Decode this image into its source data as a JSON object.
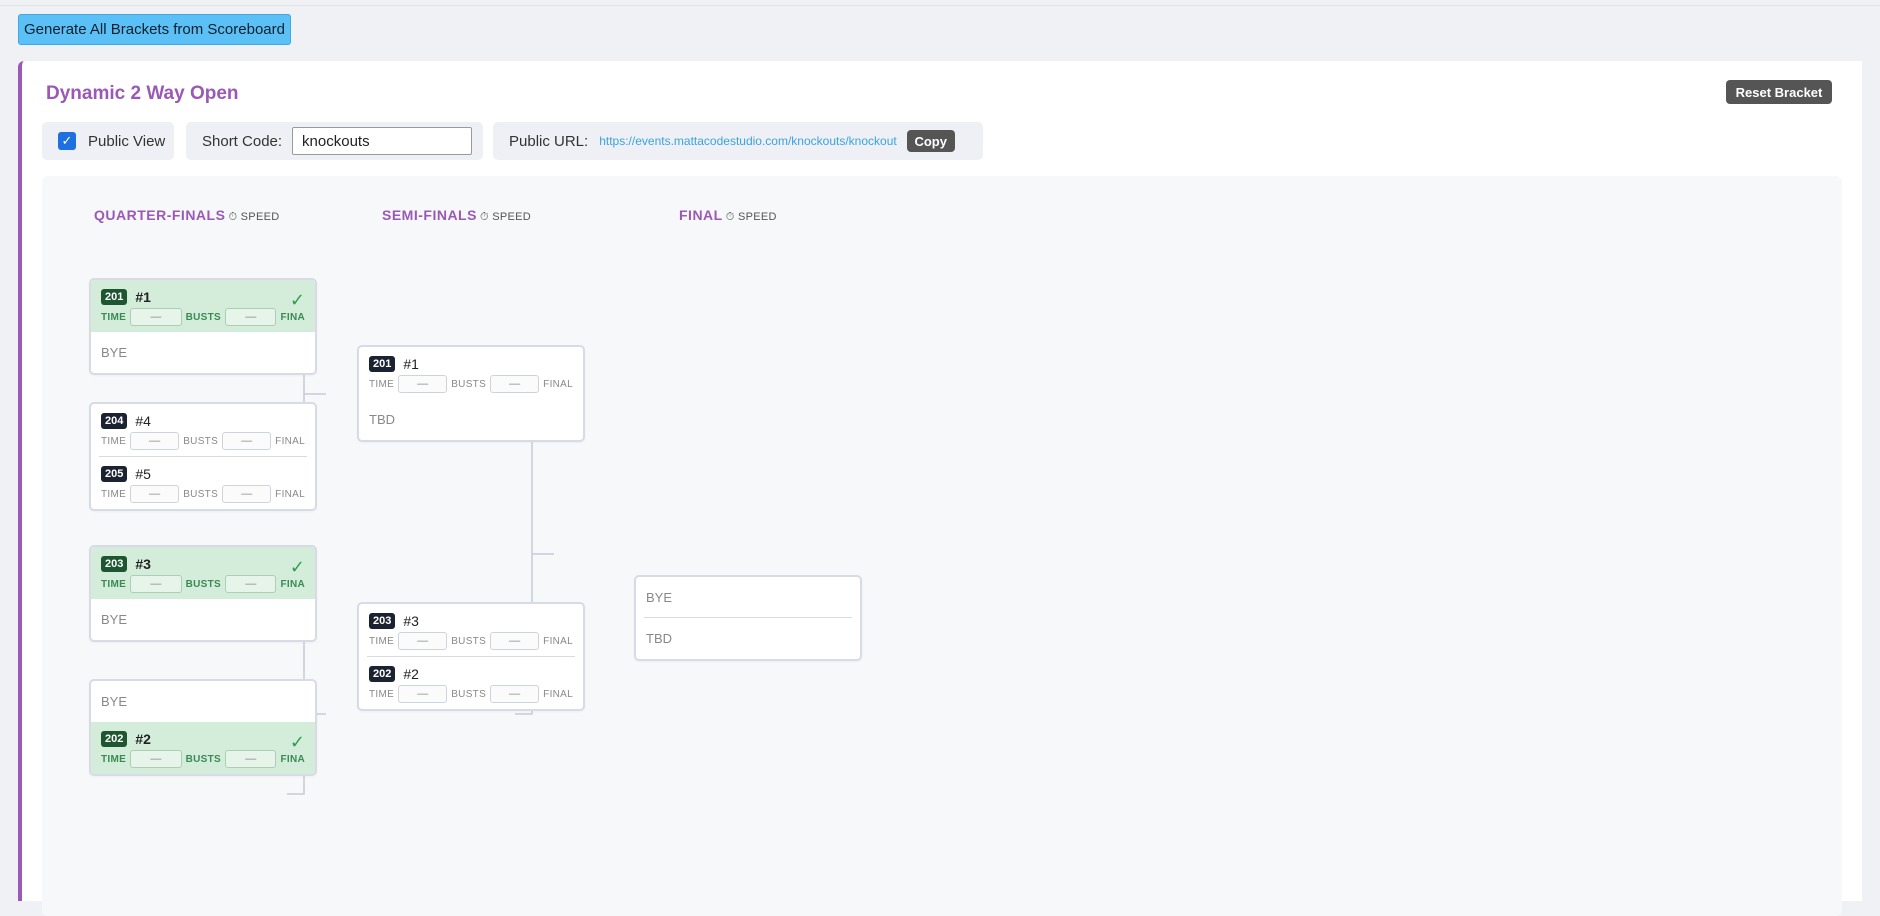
{
  "generate_label": "Generate All Brackets from Scoreboard",
  "panel": {
    "title": "Dynamic 2 Way Open",
    "reset_label": "Reset Bracket",
    "public_view_label": "Public View",
    "public_view_checked": true,
    "short_code_label": "Short Code:",
    "short_code_value": "knockouts",
    "public_url_label": "Public URL:",
    "public_url": "https://events.mattacodestudio.com/knockouts/knockout",
    "copy_label": "Copy"
  },
  "rounds": [
    {
      "title": "QUARTER-FINALS",
      "tag": "⏱ SPEED"
    },
    {
      "title": "SEMI-FINALS",
      "tag": "⏱ SPEED"
    },
    {
      "title": "FINAL",
      "tag": "⏱ SPEED"
    }
  ],
  "labels": {
    "time": "TIME",
    "busts": "BUSTS",
    "final": "FINAL",
    "final_cut": "FINA",
    "empty": "—",
    "bye": "BYE",
    "tbd": "TBD",
    "check": "✓"
  },
  "quarters": [
    {
      "a": {
        "seed": "201",
        "name": "#1",
        "winner": true
      },
      "b": "BYE"
    },
    {
      "a": {
        "seed": "204",
        "name": "#4"
      },
      "b": {
        "seed": "205",
        "name": "#5"
      }
    },
    {
      "a": {
        "seed": "203",
        "name": "#3",
        "winner": true
      },
      "b": "BYE"
    },
    {
      "a": "BYE",
      "b": {
        "seed": "202",
        "name": "#2",
        "winner": true
      }
    }
  ],
  "semis": [
    {
      "a": {
        "seed": "201",
        "name": "#1"
      },
      "b": "TBD"
    },
    {
      "a": {
        "seed": "203",
        "name": "#3"
      },
      "b": {
        "seed": "202",
        "name": "#2"
      }
    }
  ],
  "final": {
    "a": "BYE",
    "b": "TBD"
  },
  "colors": {
    "accent": "#9b59b6",
    "button": "#5bc0f5",
    "winner_bg": "#d4edda",
    "seed_bg": "#1b2333"
  }
}
